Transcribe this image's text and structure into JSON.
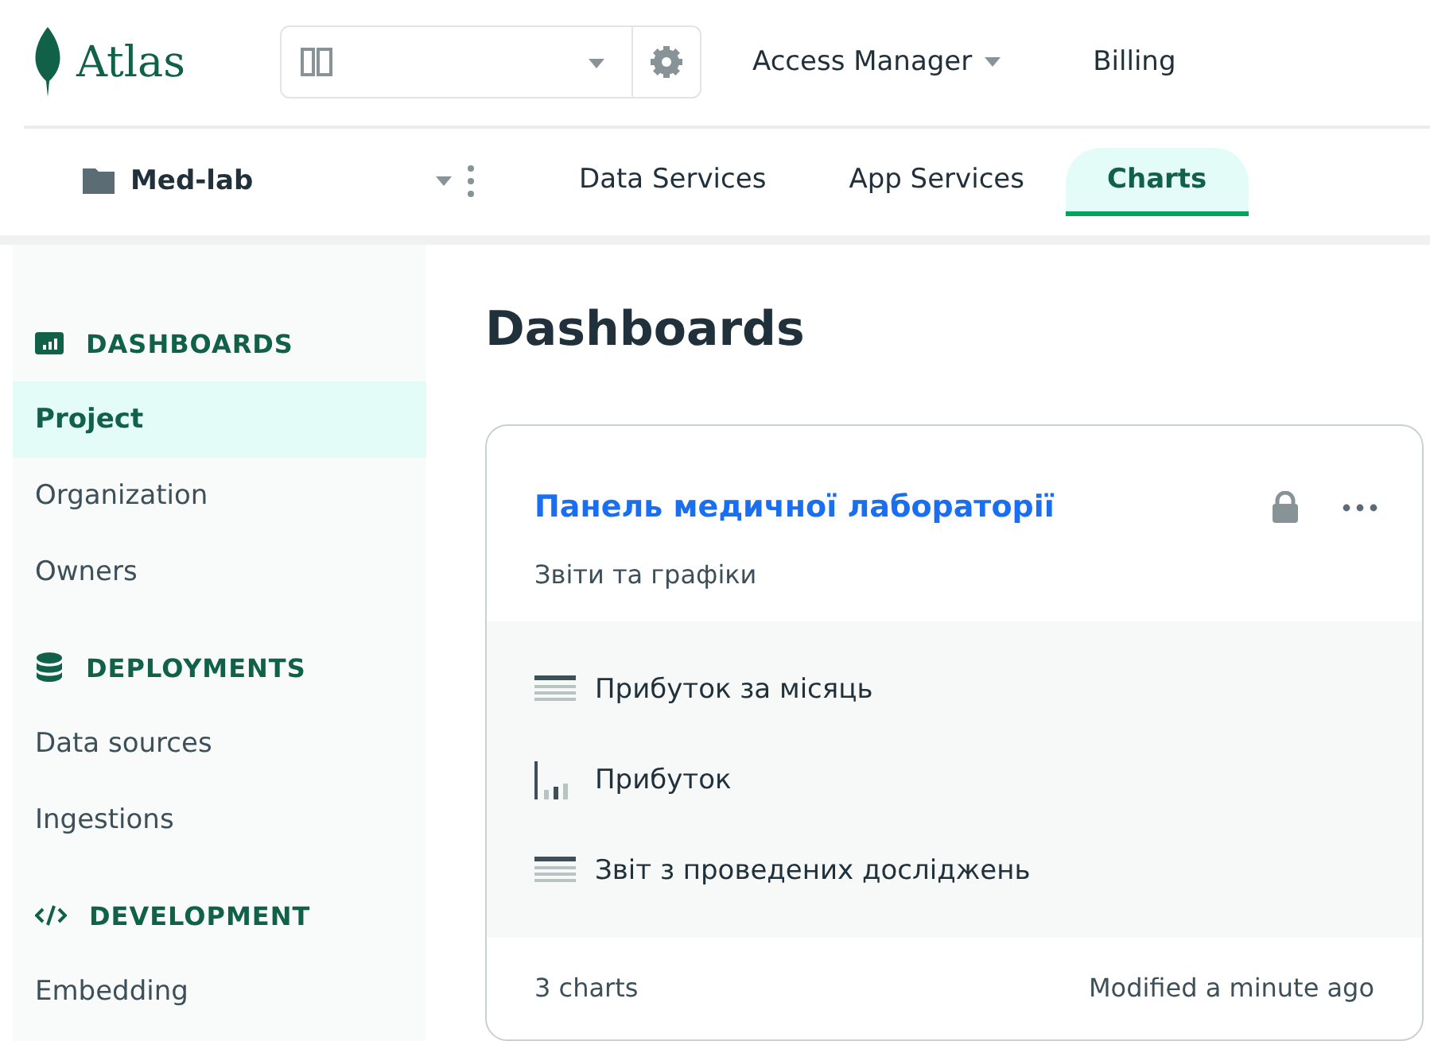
{
  "topbar": {
    "logo": "Atlas",
    "menus": [
      {
        "label": "Access Manager",
        "dropdown": true
      },
      {
        "label": "Billing",
        "dropdown": false
      }
    ]
  },
  "projectbar": {
    "project": "Med-lab",
    "tabs": [
      {
        "label": "Data Services",
        "selected": false
      },
      {
        "label": "App Services",
        "selected": false
      },
      {
        "label": "Charts",
        "selected": true
      }
    ]
  },
  "sidebar": {
    "sections": [
      {
        "kind": "chart",
        "title": "DASHBOARDS",
        "items": [
          {
            "label": "Project",
            "selected": true
          },
          {
            "label": "Organization",
            "selected": false
          },
          {
            "label": "Owners",
            "selected": false
          }
        ]
      },
      {
        "kind": "database",
        "title": "DEPLOYMENTS",
        "items": [
          {
            "label": "Data sources",
            "selected": false
          },
          {
            "label": "Ingestions",
            "selected": false
          }
        ]
      },
      {
        "kind": "code",
        "title": "DEVELOPMENT",
        "items": [
          {
            "label": "Embedding",
            "selected": false
          }
        ]
      }
    ]
  },
  "page_title": "Dashboards",
  "dashboard_card": {
    "title": "Панель медичної лабораторії",
    "locked": true,
    "description": "Звіти та графіки",
    "charts": [
      {
        "kind": "table",
        "name": "Прибуток за місяць"
      },
      {
        "kind": "bar",
        "name": "Прибуток"
      },
      {
        "kind": "table",
        "name": "Звіт з проведених досліджень"
      }
    ],
    "count": "3 charts",
    "modified": "Modified a minute ago"
  }
}
